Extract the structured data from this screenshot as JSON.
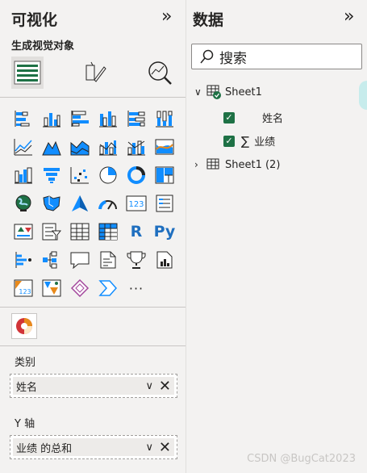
{
  "viz": {
    "title": "可视化",
    "collapse": "»",
    "subtitle": "生成视觉对象",
    "build_icons": [
      {
        "icon": "build-visual-icon",
        "selected": true
      },
      {
        "icon": "format-visual-icon",
        "selected": false
      },
      {
        "icon": "analytics-icon",
        "selected": false
      }
    ],
    "visual_types": [
      "stacked-bar-chart-icon",
      "stacked-column-chart-icon",
      "clustered-bar-chart-icon",
      "clustered-column-chart-icon",
      "100pct-stacked-bar-chart-icon",
      "100pct-stacked-column-chart-icon",
      "line-chart-icon",
      "area-chart-icon",
      "stacked-area-chart-icon",
      "line-and-stacked-column-chart-icon",
      "line-and-clustered-column-chart-icon",
      "ribbon-chart-icon",
      "waterfall-chart-icon",
      "funnel-icon",
      "scatter-chart-icon",
      "pie-chart-icon",
      "donut-chart-icon",
      "treemap-icon",
      "map-icon",
      "filled-map-icon",
      "azure-map-icon",
      "gauge-icon",
      "card-icon",
      "multi-row-card-icon",
      "kpi-icon",
      "slicer-icon",
      "table-icon",
      "matrix-icon",
      "r-script-visual-icon",
      "python-visual-icon",
      "key-influencers-icon",
      "decomposition-tree-icon",
      "qa-icon",
      "smart-narrative-icon",
      "metrics-icon",
      "paginated-report-icon",
      "power-apps-icon",
      "power-automate-icon",
      "diamond-visual-icon",
      "chevron-visual-icon",
      "more-visuals-icon"
    ],
    "more_label": "···",
    "r_label": "R",
    "py_label": "Py",
    "card_value": "123",
    "wells": [
      {
        "label": "类别",
        "value": "姓名"
      },
      {
        "label": "Y 轴",
        "value": "业绩 的总和"
      }
    ],
    "chevron_down": "∨",
    "remove": "✕"
  },
  "data": {
    "title": "数据",
    "collapse": "»",
    "search_placeholder": "搜索",
    "tables": [
      {
        "name": "Sheet1",
        "expanded": true,
        "fields": [
          {
            "name": "姓名",
            "checked": true,
            "icon": ""
          },
          {
            "name": "业绩",
            "checked": true,
            "icon": "∑"
          }
        ]
      },
      {
        "name": "Sheet1 (2)",
        "expanded": false,
        "fields": []
      }
    ]
  },
  "watermark": "CSDN @BugCat2023",
  "colors": {
    "accent": "#118dff",
    "check": "#1e7145",
    "panel": "#f3f2f1"
  }
}
